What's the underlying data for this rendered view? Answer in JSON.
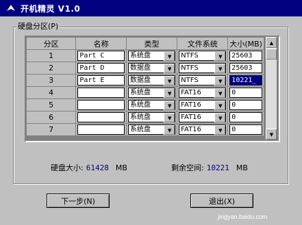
{
  "window": {
    "title": "开机精灵 V1.0"
  },
  "group": {
    "label": "硬盘分区(P)"
  },
  "table": {
    "headers": [
      "分区",
      "名称",
      "类型",
      "文件系统",
      "大小(MB)"
    ],
    "rows": [
      {
        "num": "1",
        "name": "Part C",
        "type": "系统盘",
        "fs": "NTFS",
        "size": "25603"
      },
      {
        "num": "2",
        "name": "Part D",
        "type": "数据盘",
        "fs": "NTFS",
        "size": "25603"
      },
      {
        "num": "3",
        "name": "Part E",
        "type": "数据盘",
        "fs": "NTFS",
        "size": "10221_"
      },
      {
        "num": "4",
        "name": "",
        "type": "系统盘",
        "fs": "FAT16",
        "size": "0"
      },
      {
        "num": "5",
        "name": "",
        "type": "系统盘",
        "fs": "FAT16",
        "size": "0"
      },
      {
        "num": "6",
        "name": "",
        "type": "系统盘",
        "fs": "FAT16",
        "size": "0"
      },
      {
        "num": "7",
        "name": "",
        "type": "系统盘",
        "fs": "FAT16",
        "size": "0"
      }
    ]
  },
  "status": {
    "total_label": "硬盘大小:",
    "total_value": "61428",
    "total_unit": "MB",
    "free_label": "剩余空间:",
    "free_value": "10221",
    "free_unit": "MB"
  },
  "buttons": {
    "next": "下一步(N)",
    "exit": "退出(X)"
  },
  "watermark": "jingyan.baidu.com"
}
